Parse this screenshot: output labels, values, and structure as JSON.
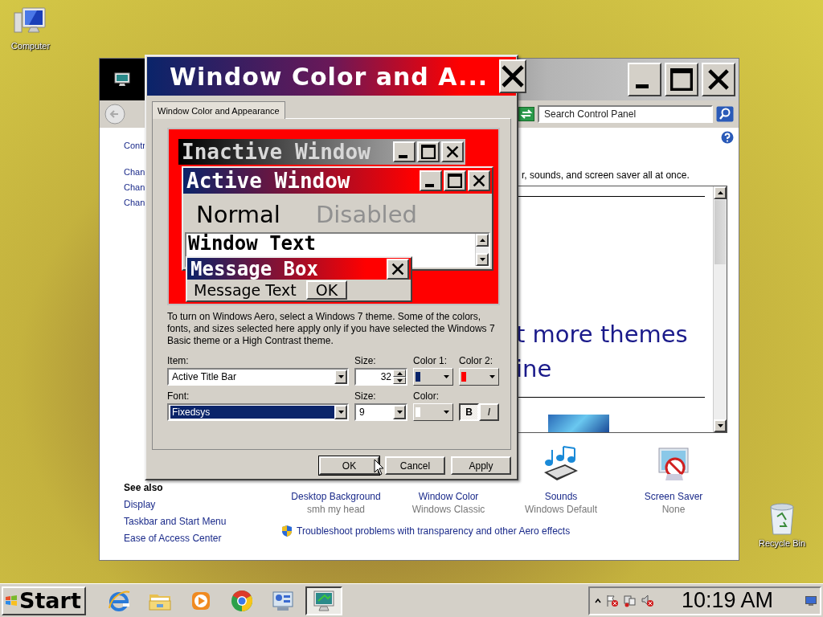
{
  "desktop": {
    "icons": [
      {
        "label": "Computer",
        "kind": "computer"
      },
      {
        "label": "Recycle Bin",
        "kind": "recycle"
      }
    ]
  },
  "control_panel_window": {
    "search_placeholder": "Search Control Panel",
    "left_links": [
      "Contr",
      "Chan",
      "Chan",
      "Chan"
    ],
    "see_also": {
      "title": "See also",
      "links": [
        "Display",
        "Taskbar and Start Menu",
        "Ease of Access Center"
      ]
    },
    "description": "r, sounds, and screen saver all at once.",
    "theme_list": {
      "lines": [
        "t more themes",
        "ine"
      ]
    },
    "settings": [
      {
        "label": "Desktop Background",
        "value": "smh my head",
        "kind": "background"
      },
      {
        "label": "Window Color",
        "value": "Windows Classic",
        "kind": "color"
      },
      {
        "label": "Sounds",
        "value": "Windows Default",
        "kind": "sounds"
      },
      {
        "label": "Screen Saver",
        "value": "None",
        "kind": "screensaver"
      }
    ],
    "troubleshoot_link": "Troubleshoot problems with transparency and other Aero effects"
  },
  "dialog": {
    "title": "Window Color and A...",
    "tabs": [
      {
        "label": "Window Color and Appearance",
        "selected": true
      }
    ],
    "preview": {
      "inactive_title": "Inactive Window",
      "active_title": "Active Window",
      "normal": "Normal",
      "disabled": "Disabled",
      "window_text": "Window Text",
      "message_title": "Message Box",
      "message_text": "Message Text",
      "ok": "OK"
    },
    "note": "To turn on Windows Aero, select a Windows 7 theme.  Some of the colors, fonts, and sizes selected here apply only if you have selected the Windows 7 Basic theme or a High Contrast theme.",
    "item": {
      "label": "Item:",
      "value": "Active Title Bar"
    },
    "item_size": {
      "label": "Size:",
      "value": "32"
    },
    "color1": {
      "label": "Color 1:",
      "color": "#0a246a"
    },
    "color2": {
      "label": "Color 2:",
      "color": "#ff0000"
    },
    "font": {
      "label": "Font:",
      "value": "Fixedsys",
      "selected": true
    },
    "font_size": {
      "label": "Size:",
      "value": "9"
    },
    "font_color": {
      "label": "Color:",
      "color": "#ffffff"
    },
    "style_buttons": [
      {
        "label": "B",
        "kind": "bold",
        "on": true
      },
      {
        "label": "I",
        "kind": "italic",
        "on": false
      }
    ],
    "buttons": [
      "OK",
      "Cancel",
      "Apply"
    ]
  },
  "taskbar": {
    "start": "Start",
    "pinned": [
      {
        "kind": "browser",
        "active": false
      },
      {
        "kind": "folder",
        "active": false
      },
      {
        "kind": "media",
        "active": false
      },
      {
        "kind": "chrome",
        "active": false
      },
      {
        "kind": "panel",
        "active": false
      },
      {
        "kind": "monitor",
        "active": true
      }
    ],
    "clock": "10:19 AM"
  }
}
